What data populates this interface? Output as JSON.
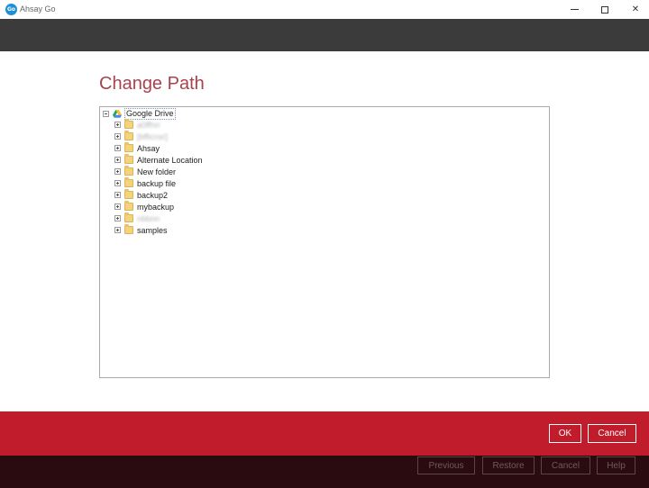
{
  "window": {
    "title": "Ahsay Go",
    "logo_text": "Go"
  },
  "page": {
    "title": "Change Path"
  },
  "tree": {
    "root": {
      "label": "Google Drive",
      "icon": "google-drive-icon",
      "expanded": true
    },
    "items": [
      {
        "label": "a0ffhrr",
        "obscured": true
      },
      {
        "label": "[bfficnsr]",
        "obscured": true
      },
      {
        "label": "Ahsay",
        "obscured": false
      },
      {
        "label": "Alternate Location",
        "obscured": false
      },
      {
        "label": "New folder",
        "obscured": false
      },
      {
        "label": "backup file",
        "obscured": false
      },
      {
        "label": "backup2",
        "obscured": false
      },
      {
        "label": "mybackup",
        "obscured": false
      },
      {
        "label": "nbbnn",
        "obscured": true
      },
      {
        "label": "samples",
        "obscured": false
      }
    ]
  },
  "dialog_buttons": {
    "ok": "OK",
    "cancel": "Cancel"
  },
  "nav_buttons": {
    "previous": "Previous",
    "restore": "Restore",
    "cancel": "Cancel",
    "help": "Help"
  },
  "colors": {
    "title_accent": "#a8424c",
    "red_bar": "#c01c2c",
    "dark_header": "#3b3b3b",
    "bottom_bar": "#2a0b10"
  }
}
